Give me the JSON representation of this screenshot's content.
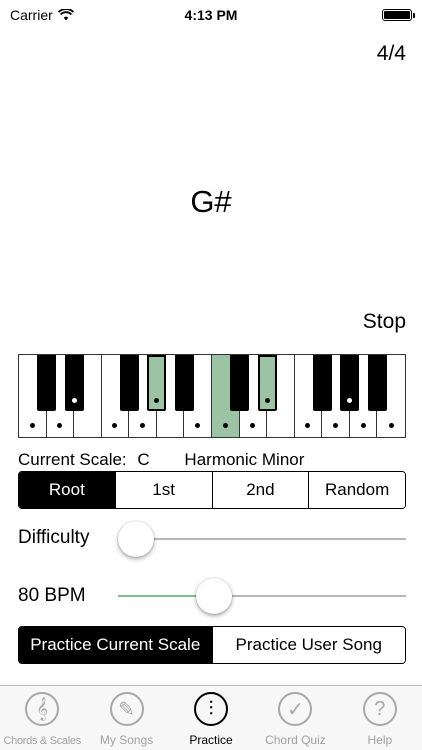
{
  "status": {
    "carrier": "Carrier",
    "time": "4:13 PM"
  },
  "time_signature": "4/4",
  "current_chord": "G#",
  "stop_label": "Stop",
  "piano": {
    "white_keys": 14,
    "highlight_color": "#9cc4a4",
    "highlighted_white": [
      7
    ],
    "highlighted_black": [
      3,
      6
    ],
    "white_dots": [
      0,
      1,
      3,
      4,
      6,
      7,
      8,
      10,
      11,
      12,
      13
    ],
    "black_dots": [
      1,
      3,
      6,
      8
    ]
  },
  "scale": {
    "label": "Current Scale:",
    "root": "C",
    "type": "Harmonic Minor"
  },
  "note_selector": {
    "options": [
      "Root",
      "1st",
      "2nd",
      "Random"
    ],
    "selected": 0
  },
  "difficulty": {
    "label": "Difficulty",
    "value": 0
  },
  "tempo": {
    "label": "80 BPM",
    "value": 0.31
  },
  "practice_mode": {
    "options": [
      "Practice Current Scale",
      "Practice User Song"
    ],
    "selected": 0
  },
  "tabs": [
    {
      "label": "Chords & Scales",
      "icon": "treble-clef-icon",
      "glyph": "𝄞",
      "active": false
    },
    {
      "label": "My Songs",
      "icon": "pencil-icon",
      "glyph": "✎",
      "active": false
    },
    {
      "label": "Practice",
      "icon": "metronome-icon",
      "glyph": "⫶",
      "active": true
    },
    {
      "label": "Chord Quiz",
      "icon": "checkmark-icon",
      "glyph": "✓",
      "active": false
    },
    {
      "label": "Help",
      "icon": "question-icon",
      "glyph": "?",
      "active": false
    }
  ]
}
